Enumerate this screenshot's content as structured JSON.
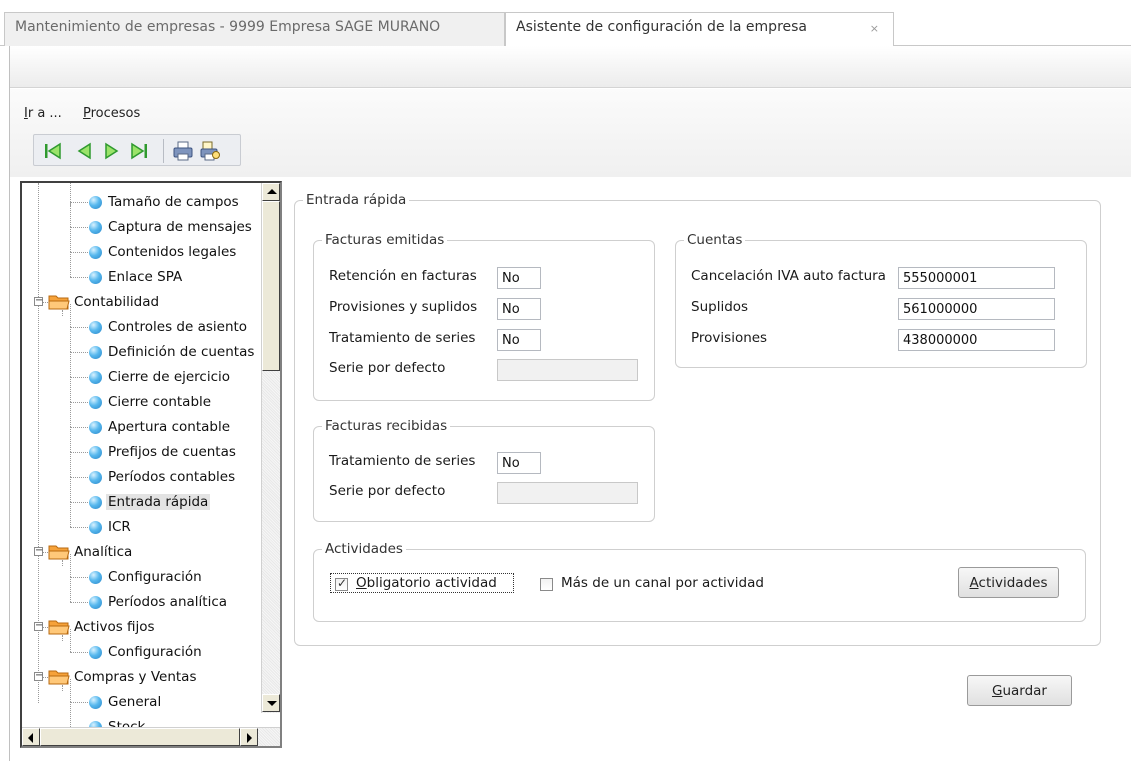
{
  "tabs": [
    {
      "label": "Mantenimiento de empresas - 9999 Empresa SAGE MURANO",
      "active": false
    },
    {
      "label": "Asistente de configuración de la empresa",
      "active": true,
      "close": "×"
    }
  ],
  "menu": {
    "goto": "Ir a ...",
    "processes": "Procesos"
  },
  "toolbar": {
    "icons": [
      "first-record-icon",
      "previous-record-icon",
      "next-record-icon",
      "last-record-icon",
      "print-icon",
      "print-preview-icon"
    ]
  },
  "tree": {
    "items": [
      {
        "label": "Tamaño de campos",
        "level": 2
      },
      {
        "label": "Captura de mensajes",
        "level": 2
      },
      {
        "label": "Contenidos legales",
        "level": 2
      },
      {
        "label": "Enlace SPA",
        "level": 2
      },
      {
        "label": "Contabilidad",
        "level": 1,
        "expander": "−"
      },
      {
        "label": "Controles de asiento",
        "level": 2
      },
      {
        "label": "Definición de cuentas",
        "level": 2
      },
      {
        "label": "Cierre de ejercicio",
        "level": 2
      },
      {
        "label": "Cierre contable",
        "level": 2
      },
      {
        "label": "Apertura contable",
        "level": 2
      },
      {
        "label": "Prefijos de cuentas",
        "level": 2
      },
      {
        "label": "Períodos contables",
        "level": 2
      },
      {
        "label": "Entrada rápida",
        "level": 2,
        "selected": true
      },
      {
        "label": "ICR",
        "level": 2
      },
      {
        "label": "Analítica",
        "level": 1,
        "expander": "−"
      },
      {
        "label": "Configuración",
        "level": 2
      },
      {
        "label": "Períodos analítica",
        "level": 2
      },
      {
        "label": "Activos fijos",
        "level": 1,
        "expander": "−"
      },
      {
        "label": "Configuración",
        "level": 2
      },
      {
        "label": "Compras y Ventas",
        "level": 1,
        "expander": "−"
      },
      {
        "label": "General",
        "level": 2
      },
      {
        "label": "Stock",
        "level": 2
      }
    ]
  },
  "main": {
    "section_title": "Entrada rápida",
    "issued": {
      "title": "Facturas emitidas",
      "withholding_label": "Retención en facturas",
      "withholding_value": "No",
      "provisions_label": "Provisiones y suplidos",
      "provisions_value": "No",
      "series_label": "Tratamiento de series",
      "series_value": "No",
      "default_series_label": "Serie por defecto",
      "default_series_value": ""
    },
    "accounts": {
      "title": "Cuentas",
      "vat_label": "Cancelación IVA auto factura",
      "vat_value": "555000001",
      "supplies_label": "Suplidos",
      "supplies_value": "561000000",
      "provisions_label": "Provisiones",
      "provisions_value": "438000000"
    },
    "received": {
      "title": "Facturas recibidas",
      "series_label": "Tratamiento de series",
      "series_value": "No",
      "default_series_label": "Serie por defecto",
      "default_series_value": ""
    },
    "activities": {
      "title": "Actividades",
      "mandatory_label": "Obligatorio actividad",
      "mandatory_checked": true,
      "multi_channel_label": "Más de un canal por actividad",
      "multi_channel_checked": false,
      "button_label": "Actividades"
    },
    "save_label": "Guardar"
  }
}
